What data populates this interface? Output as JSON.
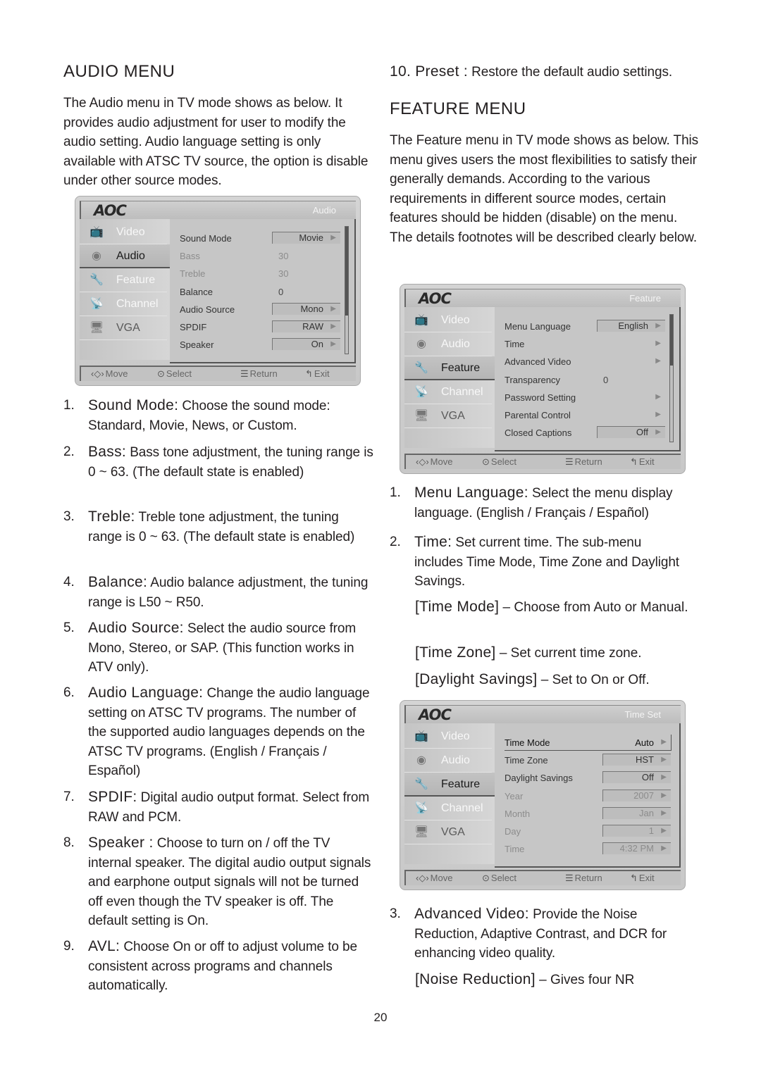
{
  "audio_section": {
    "title": "AUDIO MENU",
    "intro": "The Audio menu in TV mode shows as below. It provides audio adjustment for user to modify the audio setting. Audio language setting is only available with ATSC TV source, the option is disable under other source modes.",
    "intro_lines": [
      "The Audio menu in TV mode shows as below.",
      "It provides audio adjustment for user to modify",
      "the audio setting. Audio language setting is only",
      "available with ATSC TV source, the option is",
      "disable under other source modes."
    ],
    "items": [
      {
        "num": "1.",
        "term": "Sound Mode:",
        "text": " Choose the sound mode: Standard, Movie, News, or Custom."
      },
      {
        "num": "2.",
        "term": "Bass:",
        "text": " Bass tone adjustment, the tuning range is 0 ~ 63. (The default state is enabled)"
      },
      {
        "num": "3.",
        "term": "Treble:",
        "text": " Treble tone adjustment, the tuning range is 0 ~ 63. (The default state is enabled)"
      },
      {
        "num": "4.",
        "term": "Balance:",
        "text": " Audio balance adjustment, the tuning range is L50 ~ R50."
      },
      {
        "num": "5.",
        "term": "Audio Source:",
        "text": " Select the audio source from Mono, Stereo, or SAP. (This function works in ATV only)."
      },
      {
        "num": "6.",
        "term": "Audio Language:",
        "text": " Change the audio language setting on ATSC TV programs. The number of the supported audio languages depends on the ATSC TV programs. (English / Français / Español)"
      },
      {
        "num": "7.",
        "term": "SPDIF:",
        "text": " Digital audio output format. Select from RAW and PCM."
      },
      {
        "num": "8.",
        "term": "Speaker :",
        "text": " Choose to turn on / off the TV internal speaker. The digital audio output signals and earphone output signals will not be turned off even though the TV speaker is off. The default setting is On."
      },
      {
        "num": "9.",
        "term": "AVL:",
        "text": " Choose On or off to adjust volume to be consistent across programs and channels automatically."
      },
      {
        "num": "10.",
        "term": "Preset :",
        "text": " Restore the default audio settings."
      }
    ]
  },
  "feature_section": {
    "title": "FEATURE MENU",
    "intro": "The Feature menu in TV mode shows as below. This menu gives users the most flexibilities to satisfy their generally demands. According to the various requirements in different source modes, certain features should be hidden (disable) on the menu. The details footnotes will be described clearly below.",
    "items": [
      {
        "num": "1.",
        "term": "Menu Language:",
        "text": " Select the menu display language. (English / Français / Español)"
      },
      {
        "num": "2.",
        "term": "Time:",
        "text": " Set current time. The sub-menu includes Time Mode, Time Zone and Daylight Savings."
      },
      {
        "num": "3.",
        "term": "Advanced Video:",
        "text": " Provide the Noise Reduction, Adaptive Contrast, and DCR for enhancing video quality."
      }
    ],
    "time_subitems": [
      {
        "term": "[Time Mode]",
        "text": " – Choose from Auto or Manual."
      },
      {
        "term": "[Time Zone]",
        "text": " – Set current time zone."
      },
      {
        "term": "[Daylight Savings]",
        "text": " – Set to On or Off."
      }
    ],
    "video_subitems": [
      {
        "term": "[Noise Reduction]",
        "text": " – Gives four NR"
      }
    ]
  },
  "osd_common": {
    "logo": "AOC",
    "nav": [
      {
        "label": "Video",
        "icon": "tv-icon",
        "glyph": "📺"
      },
      {
        "label": "Audio",
        "icon": "speaker-icon",
        "glyph": "◉"
      },
      {
        "label": "Feature",
        "icon": "wrench-icon",
        "glyph": "🔧"
      },
      {
        "label": "Channel",
        "icon": "satellite-dish-icon",
        "glyph": "📡"
      },
      {
        "label": "VGA",
        "icon": "monitor-icon",
        "glyph": "🖥"
      }
    ],
    "footer": {
      "move": "Move",
      "select": "Select",
      "return": "Return",
      "exit": "Exit",
      "move_glyph": "‹◇›",
      "select_glyph": "⊙",
      "return_glyph": "☰",
      "exit_glyph": "↰"
    },
    "arrow_glyph": "▶"
  },
  "osd_audio": {
    "title": "Audio",
    "active_nav": "Audio",
    "scroll_fraction": 0.7,
    "rows": [
      {
        "label": "Sound Mode",
        "value": "Movie",
        "type": "box",
        "enabled": true
      },
      {
        "label": "Bass",
        "value": "30",
        "type": "plain",
        "enabled": false
      },
      {
        "label": "Treble",
        "value": "30",
        "type": "plain",
        "enabled": false
      },
      {
        "label": "Balance",
        "value": "0",
        "type": "plain",
        "enabled": true
      },
      {
        "label": "Audio Source",
        "value": "Mono",
        "type": "box",
        "enabled": true
      },
      {
        "label": "SPDIF",
        "value": "RAW",
        "type": "box",
        "enabled": true
      },
      {
        "label": "Speaker",
        "value": "On",
        "type": "box",
        "enabled": true
      }
    ]
  },
  "osd_feature": {
    "title": "Feature",
    "active_nav": "Feature",
    "scroll_fraction": 0.4,
    "rows": [
      {
        "label": "Menu Language",
        "value": "English",
        "type": "box",
        "enabled": true
      },
      {
        "label": "Time",
        "value": "",
        "type": "arrow",
        "enabled": true
      },
      {
        "label": "Advanced Video",
        "value": "",
        "type": "arrow",
        "enabled": true
      },
      {
        "label": "Transparency",
        "value": "0",
        "type": "plain",
        "enabled": true
      },
      {
        "label": "Password Setting",
        "value": "",
        "type": "arrow",
        "enabled": true
      },
      {
        "label": "Parental Control",
        "value": "",
        "type": "arrow",
        "enabled": true
      },
      {
        "label": "Closed Captions",
        "value": "Off",
        "type": "box",
        "enabled": true
      }
    ]
  },
  "osd_timeset": {
    "title": "Time Set",
    "active_nav": "Feature",
    "rows": [
      {
        "label": "Time Mode",
        "value": "Auto",
        "type": "highlight",
        "enabled": true
      },
      {
        "label": "Time Zone",
        "value": "HST",
        "type": "box",
        "enabled": true
      },
      {
        "label": "Daylight Savings",
        "value": "Off",
        "type": "box",
        "enabled": true
      },
      {
        "label": "Year",
        "value": "2007",
        "type": "box",
        "enabled": false
      },
      {
        "label": "Month",
        "value": "Jan",
        "type": "box",
        "enabled": false
      },
      {
        "label": "Day",
        "value": "1",
        "type": "box",
        "enabled": false
      },
      {
        "label": "Time",
        "value": "4:32 PM",
        "type": "box",
        "enabled": false
      }
    ]
  },
  "page_number": "20"
}
